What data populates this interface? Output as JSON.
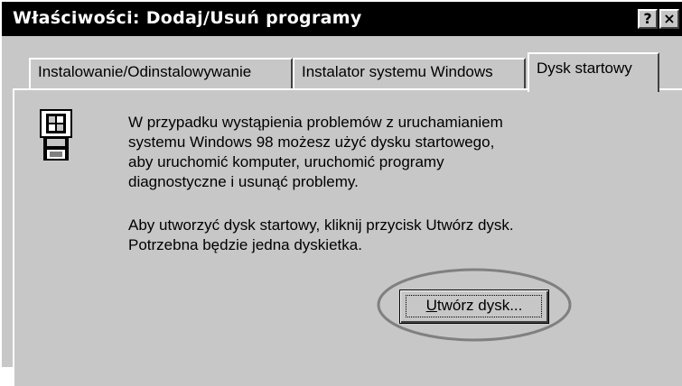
{
  "window": {
    "title": "Właściwości: Dodaj/Usuń programy",
    "help_button": "?",
    "close_button": "×"
  },
  "tabs": [
    {
      "label": "Instalowanie/Odinstalowywanie",
      "active": false
    },
    {
      "label": "Instalator systemu Windows",
      "active": false
    },
    {
      "label": "Dysk startowy",
      "active": true
    }
  ],
  "panel": {
    "icon": "floppy-disk-startup-icon",
    "description": "W przypadku wystąpienia problemów z uruchamianiem\nsystemu Windows 98 możesz użyć dysku startowego,\naby uruchomić komputer, uruchomić programy\ndiagnostyczne i usunąć problemy.",
    "instruction": "Aby utworzyć dysk startowy, kliknij przycisk Utwórz dysk.\nPotrzebna będzie jedna dyskietka.",
    "create_button": {
      "mnemonic": "U",
      "rest": "twórz dysk..."
    }
  },
  "colors": {
    "face": "#c7c7c7",
    "titlebar": "#000000",
    "highlight_ellipse": "#808080"
  }
}
